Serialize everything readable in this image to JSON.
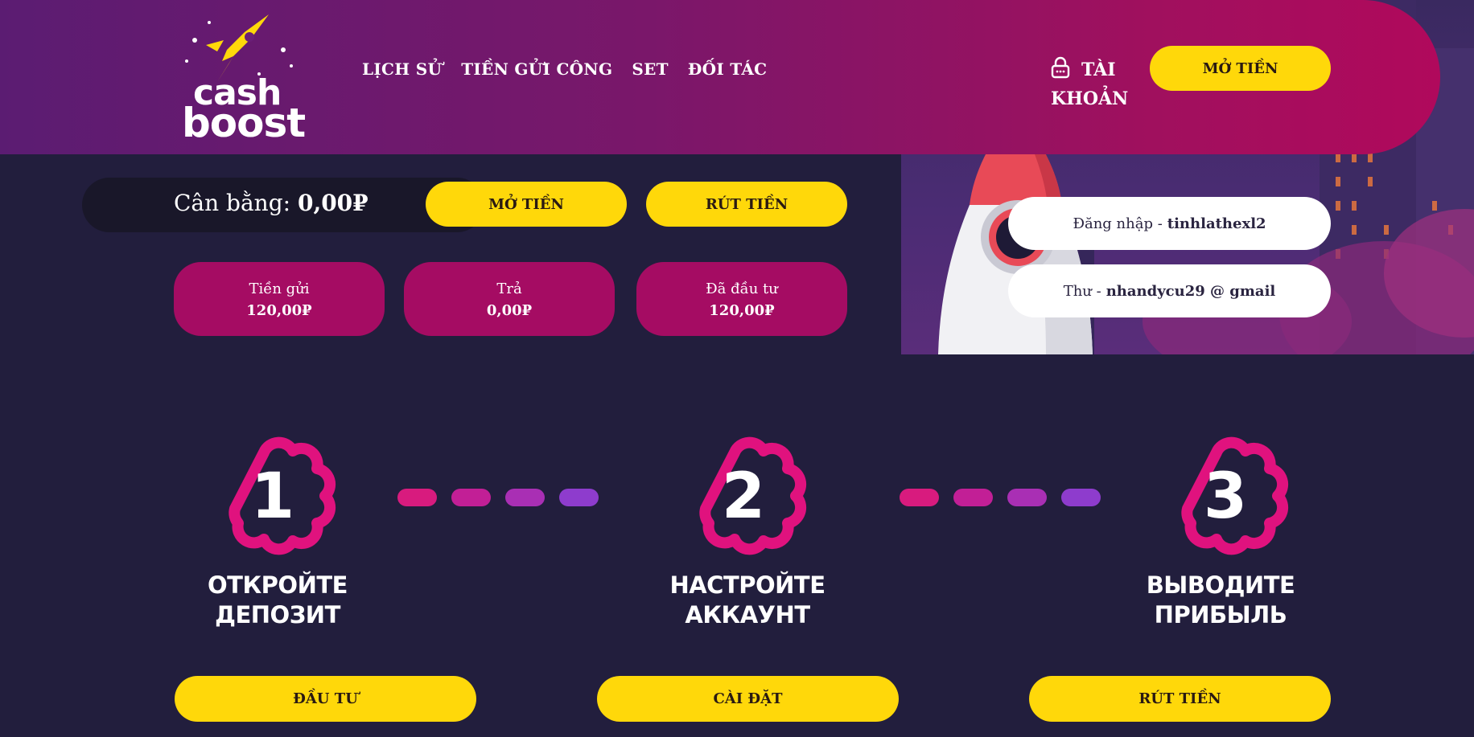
{
  "logo": {
    "line1": "cash",
    "line2": "boost"
  },
  "nav": {
    "items": [
      {
        "label": "LỊCH SỬ"
      },
      {
        "label": "TIỀN GỬI CÔNG"
      },
      {
        "label": "SET"
      },
      {
        "label": "ĐỐI TÁC"
      }
    ]
  },
  "header": {
    "account_label": "TÀI KHOẢN",
    "deposit_button": "MỞ TIỀN"
  },
  "balance": {
    "label": "Cân bằng:",
    "value": "0,00₽",
    "deposit_button": "MỞ TIỀN",
    "withdraw_button": "RÚT TIỀN"
  },
  "stats": [
    {
      "label": "Tiền gửi",
      "value": "120,00₽"
    },
    {
      "label": "Trả",
      "value": "0,00₽"
    },
    {
      "label": "Đã đầu tư",
      "value": "120,00₽"
    }
  ],
  "user": {
    "login_label": "Đăng nhập -",
    "login_value": "tinhlathexl2",
    "email_label": "Thư -",
    "email_value": "nhandycu29 @ gmail"
  },
  "steps": [
    {
      "number": "1",
      "title_line1": "ОТКРОЙТЕ",
      "title_line2": "ДЕПОЗИТ",
      "button": "ĐẦU TƯ"
    },
    {
      "number": "2",
      "title_line1": "НАСТРОЙТЕ",
      "title_line2": "АККАУНТ",
      "button": "CÀI ĐẶT"
    },
    {
      "number": "3",
      "title_line1": "ВЫВОДИТЕ",
      "title_line2": "ПРИБЫЛЬ",
      "button": "RÚT TIỀN"
    }
  ],
  "colors": {
    "accent_yellow": "#ffd80a",
    "stat_magenta": "#a50c63",
    "background": "#221e3d",
    "badge_pink": "#e0127e",
    "dash_colors": [
      "#d81b7e",
      "#c21f96",
      "#a92fb4",
      "#8e3ccd"
    ]
  }
}
